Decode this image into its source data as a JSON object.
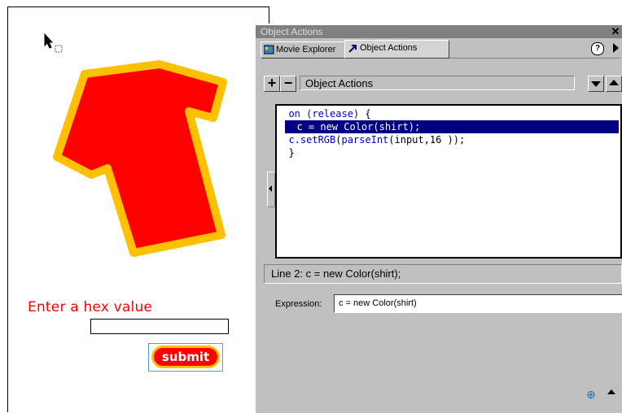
{
  "stage": {
    "hex_label": "Enter a hex value",
    "hex_input_value": "",
    "submit_label": "submit",
    "shirt_fill": "#ff0000",
    "shirt_outline": "#ffc000"
  },
  "panel": {
    "title": "Object Actions",
    "tabs": [
      {
        "label": "Movie Explorer",
        "icon": "movie-explorer-icon"
      },
      {
        "label": "Object Actions",
        "icon": "arrow-icon",
        "active": true
      }
    ],
    "help_label": "?",
    "toolbar": {
      "add_label": "+",
      "remove_label": "−",
      "title": "Object Actions"
    },
    "code": {
      "line1_kw": "on (release)",
      "line1_rest": " {",
      "line2": "  c = new Color(shirt);",
      "line3_kw": "c.setRGB",
      "line3_paren": "(",
      "line3_kw2": "parseInt",
      "line3_rest": "(input,16 ));",
      "line4": "}"
    },
    "status_text": "Line 2:  c = new Color(shirt);",
    "expression_label": "Expression:",
    "expression_value": "c = new Color(shirt)",
    "colors": {
      "highlight": "#000080",
      "keyword": "#0000cc",
      "panel_bg": "#c0c0c0"
    }
  }
}
